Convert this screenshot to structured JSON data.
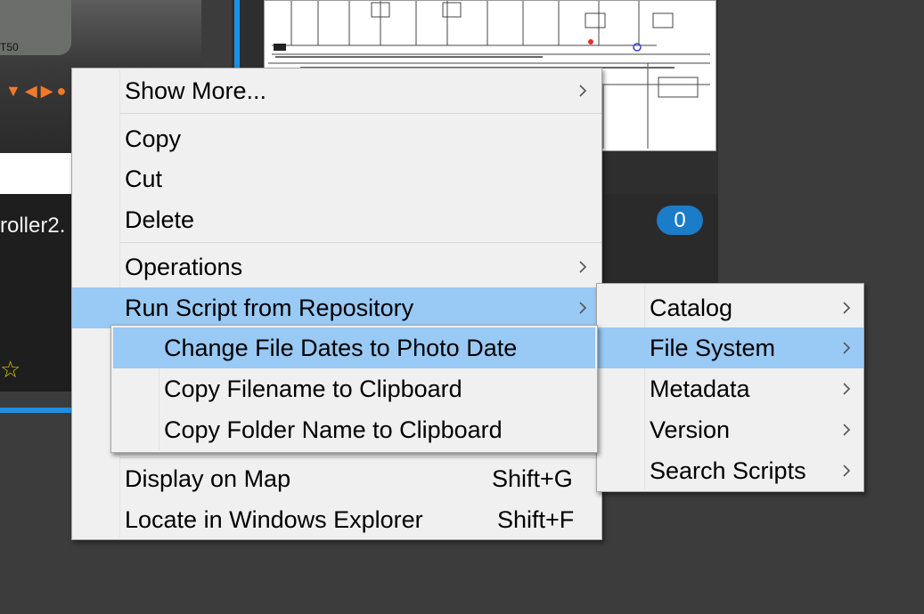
{
  "background": {
    "device_model": "T50",
    "device_buttons": "▼◀▶●",
    "left_tile_name": "roller2.",
    "left_tile_rating_star": "☆",
    "right_tile_badge": "0"
  },
  "main_menu": {
    "items": [
      {
        "label": "Show More...",
        "has_submenu": true
      },
      {
        "label": "Copy"
      },
      {
        "label": "Cut"
      },
      {
        "label": "Delete"
      },
      {
        "label": "Operations",
        "has_submenu": true
      },
      {
        "label": "Run Script from Repository",
        "has_submenu": true,
        "highlighted": true
      },
      {
        "label": "Display on Map",
        "shortcut": "Shift+G"
      },
      {
        "label": "Locate in Windows Explorer",
        "shortcut": "Shift+F"
      }
    ]
  },
  "repository_menu": {
    "items": [
      {
        "label": "Catalog",
        "has_submenu": true
      },
      {
        "label": "File System",
        "has_submenu": true,
        "highlighted": true
      },
      {
        "label": "Metadata",
        "has_submenu": true
      },
      {
        "label": "Version",
        "has_submenu": true
      },
      {
        "label": "Search Scripts",
        "has_submenu": true
      }
    ]
  },
  "file_system_menu": {
    "items": [
      {
        "label": "Change File Dates to Photo Date",
        "highlighted": true
      },
      {
        "label": "Copy Filename to Clipboard"
      },
      {
        "label": "Copy Folder Name to Clipboard"
      }
    ]
  },
  "colors": {
    "highlight": "#99c9f5",
    "menu_bg": "#f0f0f0",
    "accent_blue": "#1f8fe0"
  },
  "icons": {
    "submenu_arrow": "chevron-right-icon"
  }
}
